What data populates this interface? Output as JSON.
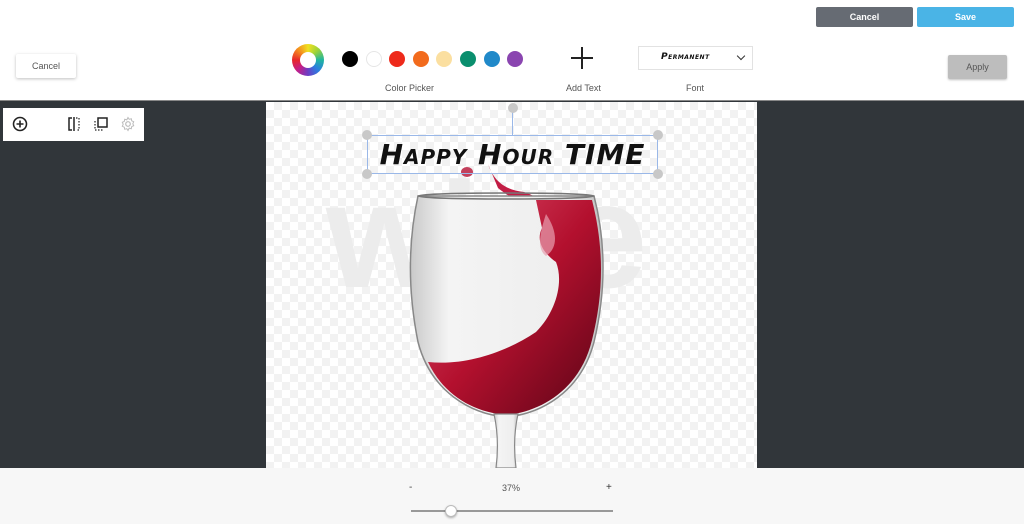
{
  "header": {
    "cancel_label": "Cancel",
    "save_label": "Save"
  },
  "toolbar": {
    "cancel_label": "Cancel",
    "color_picker_label": "Color Picker",
    "swatches": [
      {
        "name": "black",
        "color": "#000000"
      },
      {
        "name": "white",
        "color": "#ffffff"
      },
      {
        "name": "red",
        "color": "#ee2a1b"
      },
      {
        "name": "orange",
        "color": "#f26b1d"
      },
      {
        "name": "cream",
        "color": "#fbdfa0"
      },
      {
        "name": "green",
        "color": "#0a8f6e"
      },
      {
        "name": "blue",
        "color": "#2089c9"
      },
      {
        "name": "purple",
        "color": "#8a45b0"
      }
    ],
    "add_text_label": "Add Text",
    "font_label": "Font",
    "font_value": "Permanent",
    "apply_label": "Apply"
  },
  "side_tools": [
    {
      "name": "add-layer-icon"
    },
    {
      "name": "flip-icon"
    },
    {
      "name": "layer-order-icon"
    },
    {
      "name": "settings-icon",
      "disabled": true
    }
  ],
  "canvas": {
    "text_layer": "Happy Hour TIME",
    "background_word": "wine"
  },
  "zoom": {
    "minus_label": "-",
    "plus_label": "+",
    "value_label": "37%",
    "value": 0.37
  }
}
